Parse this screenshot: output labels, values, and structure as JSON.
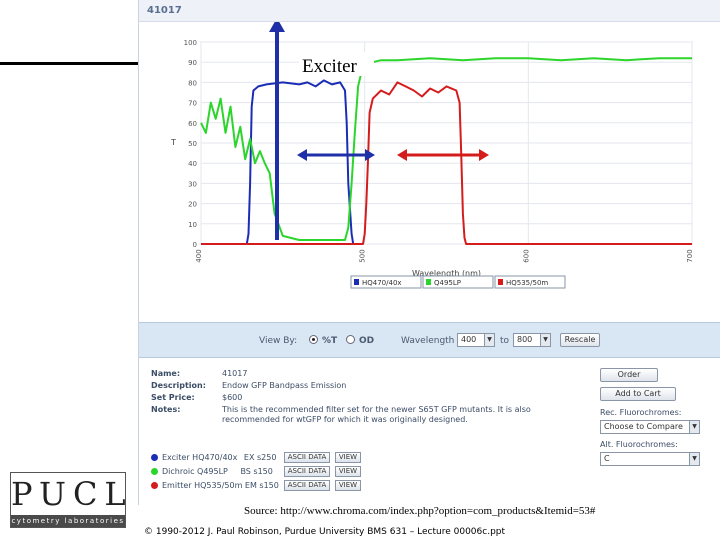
{
  "header": {
    "product_id": "41017"
  },
  "chart_data": {
    "type": "line",
    "xlabel": "Wavelength (nm)",
    "ylabel": "T",
    "xlim": [
      400,
      700
    ],
    "ylim": [
      0,
      100
    ],
    "x_ticks": [
      "400",
      "500",
      "600",
      "700"
    ],
    "y_ticks": [
      "0",
      "10",
      "20",
      "30",
      "40",
      "50",
      "60",
      "70",
      "80",
      "90",
      "100"
    ],
    "grid": true,
    "legend_position": "bottom",
    "series": [
      {
        "name": "HQ470/40x",
        "color": "#1c2db5",
        "x": [
          400,
          428,
          429,
          430,
          431,
          432,
          435,
          440,
          450,
          460,
          465,
          470,
          475,
          480,
          485,
          488,
          489,
          490,
          492,
          493
        ],
        "y": [
          0,
          0,
          5,
          30,
          68,
          76,
          78,
          79,
          80,
          79,
          80,
          78,
          81,
          79,
          80,
          76,
          60,
          30,
          5,
          0
        ]
      },
      {
        "name": "Q495LP",
        "color": "#2bd52b",
        "x": [
          400,
          403,
          406,
          409,
          412,
          415,
          418,
          421,
          424,
          427,
          430,
          433,
          436,
          439,
          442,
          445,
          450,
          460,
          470,
          480,
          488,
          490,
          492,
          494,
          496,
          498,
          500,
          502,
          505,
          510,
          520,
          540,
          560,
          580,
          600,
          620,
          640,
          660,
          680,
          700
        ],
        "y": [
          60,
          55,
          70,
          62,
          72,
          55,
          68,
          48,
          58,
          42,
          52,
          40,
          46,
          40,
          35,
          15,
          4,
          2,
          2,
          2,
          2,
          8,
          30,
          55,
          78,
          85,
          88,
          89,
          90,
          91,
          91,
          92,
          91,
          92,
          92,
          91,
          92,
          91,
          92,
          92
        ]
      },
      {
        "name": "HQ535/50m",
        "color": "#d41c1c",
        "x": [
          400,
          499,
          500,
          501,
          502,
          503,
          505,
          510,
          515,
          520,
          525,
          530,
          535,
          540,
          545,
          550,
          556,
          558,
          559,
          560,
          561,
          562,
          700
        ],
        "y": [
          0,
          0,
          5,
          20,
          40,
          65,
          72,
          76,
          74,
          80,
          78,
          76,
          73,
          77,
          75,
          78,
          76,
          70,
          45,
          15,
          3,
          0,
          0
        ]
      }
    ],
    "annotations": {
      "exciter_label": "Exciter"
    }
  },
  "controls": {
    "view_by_label": "View By:",
    "option_pct_t": "%T",
    "option_od": "OD",
    "wavelength_label": "Wavelength",
    "from_value": "400",
    "to_label": "to",
    "to_value": "800",
    "rescale_button": "Rescale"
  },
  "info": {
    "name_key": "Name:",
    "name_value": "41017",
    "description_key": "Description:",
    "description_value": "Endow GFP Bandpass Emission",
    "set_price_key": "Set Price:",
    "set_price_value": "$600",
    "notes_key": "Notes:",
    "notes_line1": "This is the recommended filter set for the newer S65T GFP mutants. It is also",
    "notes_line2": "recommended for wtGFP for which it was originally designed."
  },
  "components": [
    {
      "label": "Exciter",
      "part": "HQ470/40x",
      "size": "EX s250",
      "ascii": "ASCII DATA",
      "view": "VIEW",
      "color": "#1c2db5"
    },
    {
      "label": "Dichroic",
      "part": "Q495LP",
      "size": "BS s150",
      "ascii": "ASCII DATA",
      "view": "VIEW",
      "color": "#2bd52b"
    },
    {
      "label": "Emitter",
      "part": "HQ535/50m",
      "size": "EM s150",
      "ascii": "ASCII DATA",
      "view": "VIEW",
      "color": "#d41c1c"
    }
  ],
  "sidebar": {
    "order_button": "Order",
    "add_to_cart_button": "Add to Cart",
    "rec_fluorochromes_label": "Rec. Fluorochromes:",
    "compare_select": "Choose to Compare",
    "alt_fluorochromes_label": "Alt. Fluorochromes:",
    "alt_select": "C"
  },
  "logo": {
    "name": "PUCL",
    "subtitle": "cytometry laboratories"
  },
  "footer": {
    "source": "Source: http://www.chroma.com/index.php?option=com_products&Itemid=53#",
    "copyright": "© 1990-2012 J. Paul Robinson, Purdue University BMS 631 – Lecture 00006c.ppt"
  }
}
